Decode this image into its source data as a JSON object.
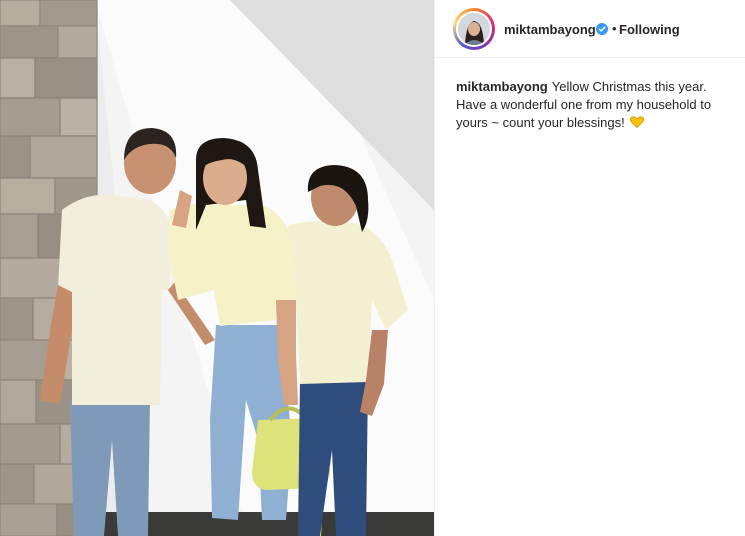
{
  "post": {
    "username": "miktambayong",
    "follow_status": "Following",
    "separator": "•",
    "caption_user": "miktambayong",
    "caption_text": "Yellow Christmas this year. Have a wonderful one from my household to yours ~ count your blessings!"
  },
  "icons": {
    "verified": "verified-badge-icon",
    "heart": "yellow-heart-emoji"
  },
  "colors": {
    "verified_blue": "#3897f0",
    "heart_yellow": "#f7c200",
    "text": "#262626"
  }
}
